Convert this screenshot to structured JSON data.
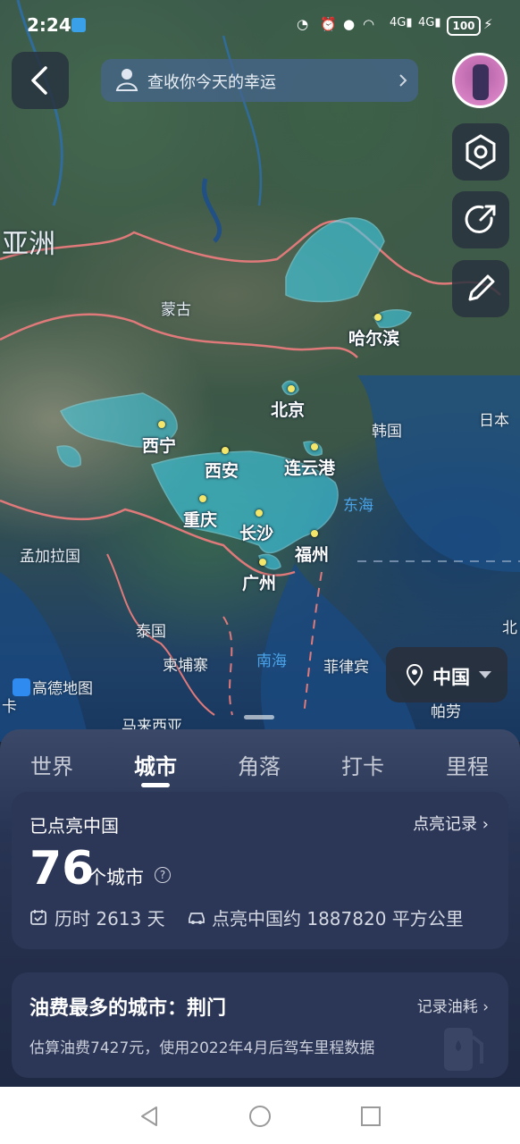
{
  "status_bar": {
    "time": "2:24",
    "battery": "100"
  },
  "top": {
    "fortune_text": "查收你今天的幸运"
  },
  "map": {
    "continent_label": "亚洲",
    "region_labels": [
      "蒙古",
      "韩国",
      "日本",
      "孟加拉国",
      "泰国",
      "柬埔寨",
      "菲律宾",
      "马来西亚",
      "帕劳",
      "北",
      "卡"
    ],
    "sea_labels": [
      "东海",
      "南海"
    ],
    "cities": [
      {
        "name": "哈尔滨"
      },
      {
        "name": "北京"
      },
      {
        "name": "西宁"
      },
      {
        "name": "西安"
      },
      {
        "name": "连云港"
      },
      {
        "name": "重庆"
      },
      {
        "name": "长沙"
      },
      {
        "name": "福州"
      },
      {
        "name": "广州"
      }
    ],
    "provider_logo": "高德地图",
    "region_picker": "中国",
    "colors": {
      "lit_region": "#3fd0ea",
      "border": "#e07a7a",
      "city_dot": "#f3e66a"
    }
  },
  "tabs": [
    "世界",
    "城市",
    "角落",
    "打卡",
    "里程"
  ],
  "active_tab": "城市",
  "lit_card": {
    "title": "已点亮中国",
    "record_link": "点亮记录",
    "count": "76",
    "unit": "个城市",
    "help_symbol": "?",
    "days": "历时 2613 天",
    "area": "点亮中国约 1887820 平方公里"
  },
  "fuel_card": {
    "title": "油费最多的城市：荆门",
    "record_link": "记录油耗",
    "detail": "估算油费7427元，使用2022年4月后驾车里程数据"
  }
}
